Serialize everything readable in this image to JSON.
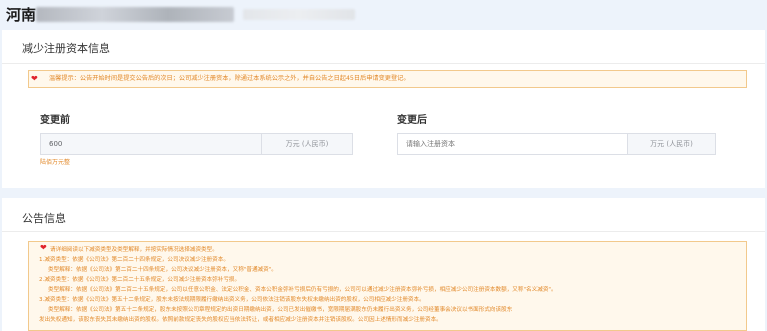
{
  "header": {
    "company_prefix": "河南"
  },
  "reduce_section": {
    "title": "减少注册资本信息",
    "notice": "温馨提示：公告开始时间是提交公告后的次日；公司减少注册资本，除通过本系统公示之外，并自公告之日起45日后申请变更登记。",
    "before": {
      "label": "变更前",
      "value": "600",
      "unit": "万元 (人民币)",
      "words": "陆佰万元整"
    },
    "after": {
      "label": "变更后",
      "placeholder": "请输入注册资本",
      "unit": "万元 (人民币)"
    }
  },
  "announce_section": {
    "title": "公告信息",
    "lines": [
      "请详细阅读以下减资类型及类型解释，并按实际情况选择减资类型。",
      "1.减资类型：依据《公司法》第二百二十四条规定，公司决议减少注册资本。",
      "类型解释：依据《公司法》第二百二十四条规定，公司决议减少注册资本，又称\"普通减资\"。",
      "2.减资类型：依据《公司法》第二百二十五条规定，公司减少注册资本弥补亏损。",
      "类型解释：依据《公司法》第二百二十五条规定，公司以任意公积金、法定公积金、资本公积金弥补亏损后仍有亏损的，公司可以通过减少注册资本弥补亏损，相应减少公司注册资本数额，又称\"名义减资\"。",
      "3.减资类型：依据《公司法》第五十二条规定，股东未按法规期限履行缴纳出资义务，公司依法注销该股东失权未缴纳出资的股权，公司相应减少注册资本。",
      "类型解释：依据《公司法》第五十二条规定，股东未按照公司章程规定的出资日期缴纳出资，公司已发出催缴书，宽限期届满股东仍未履行出资义务，公司经董事会决议以书面形式向该股东",
      "发出失权通知，该股东丧失其未缴纳出资的股权。依照前款规定丧失的股权应当依法转让，或者相应减少注册资本并注销该股权。公司因上述情形而减少注册资本。"
    ]
  }
}
